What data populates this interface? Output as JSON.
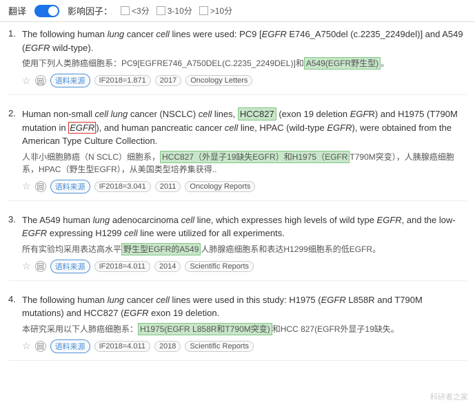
{
  "topbar": {
    "translate_label": "翻译",
    "factor_label": "影响因子：",
    "filter_less3_label": "<3分",
    "filter_3to10_label": "3-10分",
    "filter_more10_label": ">10分"
  },
  "results": [
    {
      "number": "1.",
      "en_text_parts": [
        {
          "text": "The following human ",
          "type": "normal"
        },
        {
          "text": "lung",
          "type": "italic"
        },
        {
          "text": " cancer ",
          "type": "normal"
        },
        {
          "text": "cell",
          "type": "italic"
        },
        {
          "text": " lines were used: PC9 [",
          "type": "normal"
        },
        {
          "text": "EGFR",
          "type": "italic-red"
        },
        {
          "text": " E746_A750del (c.2235_2249del)] and A549 (",
          "type": "normal"
        },
        {
          "text": "EGFR",
          "type": "italic-red"
        },
        {
          "text": " wild-type).",
          "type": "normal"
        }
      ],
      "cn_text": "使用下列人类肺癌细胞系：PC9[EGFRE746_A750DEL(C.2235_2249DEL)]和",
      "cn_highlight": "A549(EGFR野生型)。",
      "source_label": "语料来源",
      "if_label": "IF2018=1.871",
      "year_label": "2017",
      "journal_label": "Oncology Letters"
    },
    {
      "number": "2.",
      "en_text_parts": [
        {
          "text": "Human non-small ",
          "type": "normal"
        },
        {
          "text": "cell lung",
          "type": "italic"
        },
        {
          "text": " cancer (NSCLC) ",
          "type": "normal"
        },
        {
          "text": "cell",
          "type": "italic"
        },
        {
          "text": " lines, ",
          "type": "normal"
        },
        {
          "text": "HCC827",
          "type": "highlight-green"
        },
        {
          "text": " (exon 19 deletion ",
          "type": "normal"
        },
        {
          "text": "EGF",
          "type": "italic-red"
        },
        {
          "text": "R) and H1975 (T790M mutation in ",
          "type": "normal"
        },
        {
          "text": "EGFR",
          "type": "italic-red-box"
        },
        {
          "text": "), and human pancreatic cancer ",
          "type": "normal"
        },
        {
          "text": "cell",
          "type": "italic"
        },
        {
          "text": " line, HPAC (wild-type ",
          "type": "normal"
        },
        {
          "text": "EGFR",
          "type": "italic-red"
        },
        {
          "text": "), were obtained from the American Type Culture Collection.",
          "type": "normal"
        }
      ],
      "cn_text": "人非小细胞肺癌（N SCLC）细胞系，",
      "cn_highlight1": "HCC827（外显子19缺失EGFR）和H1975（EGFR",
      "cn_text2": "T790M突变），人胰腺癌细胞系，HPAC（野生型EGFR），从美国类型培养集获得..",
      "source_label": "语料来源",
      "if_label": "IF2018=3.041",
      "year_label": "2011",
      "journal_label": "Oncology Reports"
    },
    {
      "number": "3.",
      "en_text_parts": [
        {
          "text": "The A549 human ",
          "type": "normal"
        },
        {
          "text": "lung",
          "type": "italic"
        },
        {
          "text": " adenocarcinoma ",
          "type": "normal"
        },
        {
          "text": "cell",
          "type": "italic"
        },
        {
          "text": " line, which expresses high levels of wild type ",
          "type": "normal"
        },
        {
          "text": "EGFR",
          "type": "italic-red"
        },
        {
          "text": ", and the low-",
          "type": "normal"
        },
        {
          "text": "EGFR",
          "type": "italic-red"
        },
        {
          "text": " expressing H1299 ",
          "type": "normal"
        },
        {
          "text": "cell",
          "type": "italic"
        },
        {
          "text": " line were utilized for all experiments.",
          "type": "normal"
        }
      ],
      "cn_text": "所有实验均采用表达高水平",
      "cn_highlight": "野生型EGFR的A549",
      "cn_text2": "人肺腺癌细胞系和表达H1299细胞系的低EGFR。",
      "source_label": "语料来源",
      "if_label": "IF2018=4.011",
      "year_label": "2014",
      "journal_label": "Scientific Reports"
    },
    {
      "number": "4.",
      "en_text_parts": [
        {
          "text": "The following human ",
          "type": "normal"
        },
        {
          "text": "lung",
          "type": "italic"
        },
        {
          "text": " cancer ",
          "type": "normal"
        },
        {
          "text": "cell",
          "type": "italic"
        },
        {
          "text": " lines were used in this study: H1975 (",
          "type": "normal"
        },
        {
          "text": "EGFR",
          "type": "italic-red"
        },
        {
          "text": " L858R and T790M mutations) and HCC827 (",
          "type": "normal"
        },
        {
          "text": "EGFR",
          "type": "italic-red"
        },
        {
          "text": " exon 19 deletion.",
          "type": "normal"
        }
      ],
      "cn_text": "本研究采用以下人肺癌细胞系：",
      "cn_highlight": "H1975(EGFR L858R和T790M突变)",
      "cn_text2": "和HCC 827(EGFR外显子19缺失。",
      "source_label": "语料来源",
      "if_label": "IF2018=4.011",
      "year_label": "2018",
      "journal_label": "Scientific Reports"
    }
  ],
  "watermark": "科研者之家"
}
